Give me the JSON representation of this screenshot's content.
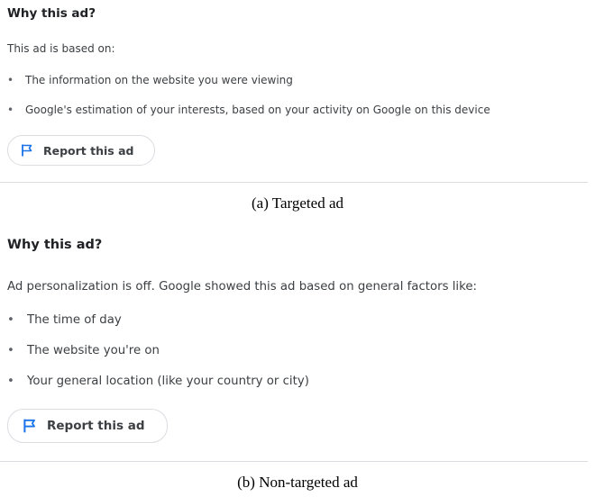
{
  "targeted": {
    "title": "Why this ad?",
    "intro": "This ad is based on:",
    "bullets": [
      "The information on the website you were viewing",
      "Google's estimation of your interests, based on your activity on Google on this device"
    ],
    "report_label": "Report this ad",
    "caption": "(a) Targeted ad"
  },
  "non_targeted": {
    "title": "Why this ad?",
    "intro": "Ad personalization is off. Google showed this ad based on general factors like:",
    "bullets": [
      "The time of day",
      "The website you're on",
      "Your general location (like your country or city)"
    ],
    "report_label": "Report this ad",
    "caption": "(b) Non-targeted ad"
  },
  "icons": {
    "report": "flag-icon",
    "bullet": "bullet-dot"
  },
  "colors": {
    "accent": "#1a73e8",
    "text": "#3c4043",
    "title": "#202124",
    "border": "#dadce0"
  }
}
